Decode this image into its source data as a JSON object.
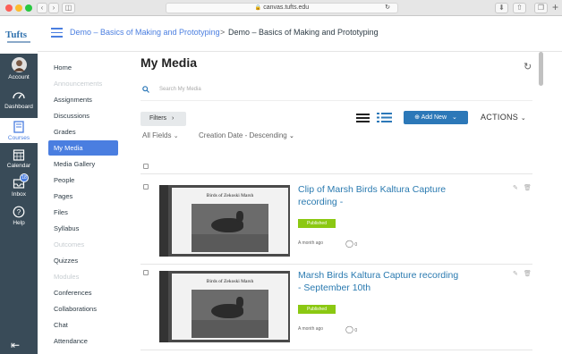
{
  "browser": {
    "url": "canvas.tufts.edu"
  },
  "logo": "Tufts",
  "global_nav": [
    {
      "label": "Account",
      "icon": "avatar"
    },
    {
      "label": "Dashboard",
      "icon": "dashboard-icon"
    },
    {
      "label": "Courses",
      "icon": "courses-icon"
    },
    {
      "label": "Calendar",
      "icon": "calendar-icon"
    },
    {
      "label": "Inbox",
      "icon": "inbox-icon",
      "badge": "18"
    },
    {
      "label": "Help",
      "icon": "help-icon"
    }
  ],
  "breadcrumb": {
    "course": "Demo – Basics of Making and Prototyping",
    "separator": ">",
    "current": "Demo – Basics of Making and Prototyping"
  },
  "course_nav": [
    {
      "label": "Home",
      "disabled": false
    },
    {
      "label": "Announcements",
      "disabled": true
    },
    {
      "label": "Assignments",
      "disabled": false
    },
    {
      "label": "Discussions",
      "disabled": false
    },
    {
      "label": "Grades",
      "disabled": false
    },
    {
      "label": "My Media",
      "disabled": false,
      "active": true
    },
    {
      "label": "Media Gallery",
      "disabled": false
    },
    {
      "label": "People",
      "disabled": false
    },
    {
      "label": "Pages",
      "disabled": false
    },
    {
      "label": "Files",
      "disabled": false
    },
    {
      "label": "Syllabus",
      "disabled": false
    },
    {
      "label": "Outcomes",
      "disabled": true
    },
    {
      "label": "Quizzes",
      "disabled": false
    },
    {
      "label": "Modules",
      "disabled": true
    },
    {
      "label": "Conferences",
      "disabled": false
    },
    {
      "label": "Collaborations",
      "disabled": false
    },
    {
      "label": "Chat",
      "disabled": false
    },
    {
      "label": "Attendance",
      "disabled": false
    }
  ],
  "main": {
    "title": "My Media",
    "search_placeholder": "Search My Media",
    "filters_label": "Filters",
    "filter_all_fields": "All Fields",
    "sort_label": "Creation Date - Descending",
    "add_new_label": "Add New",
    "actions_label": "ACTIONS"
  },
  "media_items": [
    {
      "title": "Clip of Marsh Birds Kaltura Capture recording -",
      "status": "Published",
      "when": "A month ago",
      "comments": "0",
      "thumb_caption": "Birds of Zekoski Marsh"
    },
    {
      "title": "Marsh Birds Kaltura Capture recording - September 10th",
      "status": "Published",
      "when": "A month ago",
      "comments": "0",
      "thumb_caption": "Birds of Zekoski Marsh"
    }
  ],
  "colors": {
    "global_nav_bg": "#394b58",
    "accent": "#4a7ee0",
    "link": "#2a7ab0",
    "add_button": "#2c78b8",
    "published": "#8bc812"
  }
}
